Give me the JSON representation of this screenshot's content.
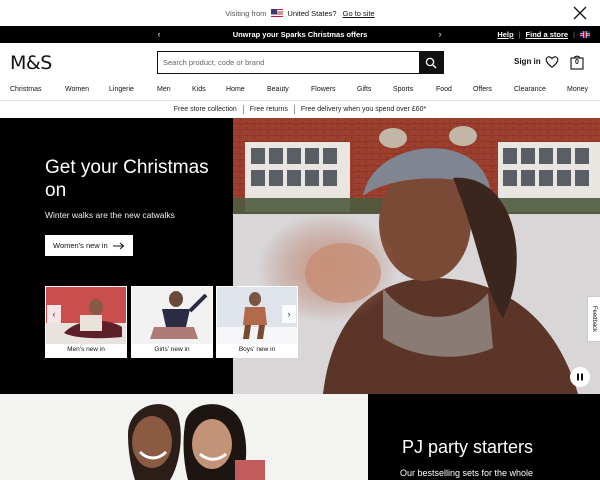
{
  "country_bar": {
    "prefix": "Visiting from",
    "country": "United States?",
    "link": "Go to site"
  },
  "promo": {
    "message": "Unwrap your Sparks Christmas offers",
    "links": [
      "Help",
      "Find a store"
    ]
  },
  "header": {
    "logo": "M&S",
    "search_placeholder": "Search product, code or brand",
    "signin": "Sign in",
    "bag_count": "0"
  },
  "nav": [
    "Christmas",
    "Women",
    "Lingerie",
    "Men",
    "Kids",
    "Home",
    "Beauty",
    "Flowers",
    "Gifts",
    "Sports",
    "Food",
    "Offers",
    "Clearance",
    "Money"
  ],
  "service": [
    "Free store collection",
    "Free returns",
    "Free delivery when you spend over £60*"
  ],
  "hero": {
    "title": "Get your Christmas on",
    "subtitle": "Winter walks are the new catwalks",
    "button": "Women's new in",
    "tiles": [
      "Men's new in",
      "Girls' new in",
      "Boys' new in"
    ],
    "feedback": "Feedback"
  },
  "pj": {
    "title": "PJ party starters",
    "subtitle": "Our bestselling sets for the whole"
  },
  "colors": {
    "black": "#000000",
    "white": "#ffffff",
    "brick": "#9c3f2e"
  }
}
